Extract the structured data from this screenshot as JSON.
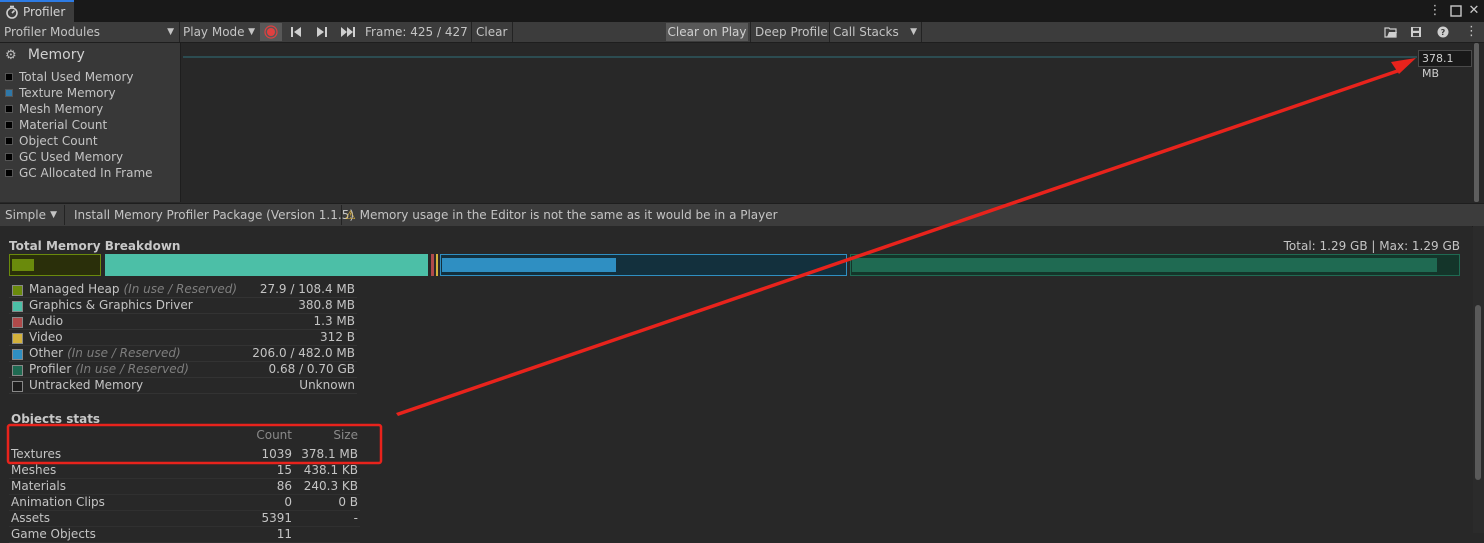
{
  "window": {
    "tab_title": "Profiler",
    "menu_icon": "kebab-menu-icon",
    "maximize_icon": "maximize-icon",
    "close_icon": "close-icon"
  },
  "toolbar": {
    "modules_dropdown": "Profiler Modules",
    "play_mode": "Play Mode",
    "frame": "Frame: 425 / 427",
    "clear": "Clear",
    "clear_on_play": "Clear on Play",
    "deep_profile": "Deep Profile",
    "call_stacks": "Call Stacks"
  },
  "module": {
    "title": "Memory",
    "items": [
      {
        "label": "Total Used Memory",
        "color": "#000000"
      },
      {
        "label": "Texture Memory",
        "color": "#2f78a8"
      },
      {
        "label": "Mesh Memory",
        "color": "#000000"
      },
      {
        "label": "Material Count",
        "color": "#000000"
      },
      {
        "label": "Object Count",
        "color": "#000000"
      },
      {
        "label": "GC Used Memory",
        "color": "#000000"
      },
      {
        "label": "GC Allocated In Frame",
        "color": "#000000"
      }
    ]
  },
  "graph": {
    "value_label": "378.1 MB",
    "line_color": "#2f6f7a"
  },
  "details_bar": {
    "view_mode": "Simple",
    "install_package": "Install Memory Profiler Package (Version 1.1.5)",
    "warning": "Memory usage in the Editor is not the same as it would be in a Player"
  },
  "breakdown": {
    "title": "Total Memory Breakdown",
    "total": "Total: 1.29 GB | Max: 1.29 GB",
    "legend": [
      {
        "label": "Managed Heap",
        "note": "(In use / Reserved)",
        "value": "27.9 / 108.4 MB",
        "color": "#6a8a0c"
      },
      {
        "label": "Graphics & Graphics Driver",
        "note": "",
        "value": "380.8 MB",
        "color": "#4cbfa7"
      },
      {
        "label": "Audio",
        "note": "",
        "value": "1.3 MB",
        "color": "#b04a4a"
      },
      {
        "label": "Video",
        "note": "",
        "value": "312 B",
        "color": "#d4b23c"
      },
      {
        "label": "Other",
        "note": "(In use / Reserved)",
        "value": "206.0 / 482.0 MB",
        "color": "#2f8fc2"
      },
      {
        "label": "Profiler",
        "note": "(In use / Reserved)",
        "value": "0.68 / 0.70 GB",
        "color": "#1f6a52"
      },
      {
        "label": "Untracked Memory",
        "note": "",
        "value": "Unknown",
        "color": "#1c1c1c"
      }
    ]
  },
  "objects_stats": {
    "title": "Objects stats",
    "headers": {
      "count": "Count",
      "size": "Size"
    },
    "rows": [
      {
        "name": "Textures",
        "count": "1039",
        "size": "378.1 MB"
      },
      {
        "name": "Meshes",
        "count": "15",
        "size": "438.1 KB"
      },
      {
        "name": "Materials",
        "count": "86",
        "size": "240.3 KB"
      },
      {
        "name": "Animation Clips",
        "count": "0",
        "size": "0 B"
      },
      {
        "name": "Assets",
        "count": "5391",
        "size": "-"
      },
      {
        "name": "Game Objects",
        "count": "11",
        "size": ""
      }
    ]
  },
  "annotation": {
    "color": "#e8231c"
  }
}
